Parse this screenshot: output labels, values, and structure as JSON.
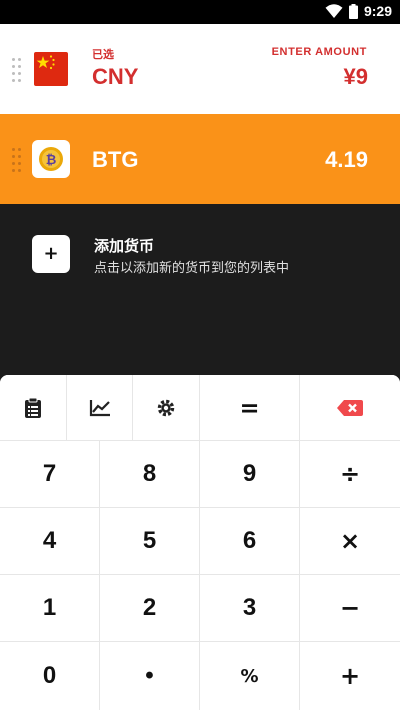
{
  "status_bar": {
    "time": "9:29",
    "icons": [
      "wifi-icon",
      "battery-icon"
    ]
  },
  "base_currency": {
    "code": "CNY",
    "selected_label": "已选",
    "enter_amount_label": "ENTER AMOUNT",
    "amount": "¥9",
    "flag": "china-flag-icon",
    "accent_color": "#d32f2f"
  },
  "target_currency": {
    "code": "BTG",
    "value": "4.19",
    "icon": "bitcoin-gold-icon",
    "row_color": "#fa9218"
  },
  "add_currency": {
    "button_label": "+",
    "title": "添加货币",
    "subtitle": "点击以添加新的货币到您的列表中"
  },
  "toolbar": {
    "items": [
      "clipboard-icon",
      "chart-icon",
      "settings-icon",
      "equals-icon",
      "backspace-icon"
    ],
    "equals_label": "="
  },
  "keypad": {
    "rows": [
      [
        "7",
        "8",
        "9",
        "÷"
      ],
      [
        "4",
        "5",
        "6",
        "×"
      ],
      [
        "1",
        "2",
        "3",
        "−"
      ],
      [
        "0",
        "•",
        "%",
        "+"
      ]
    ]
  }
}
